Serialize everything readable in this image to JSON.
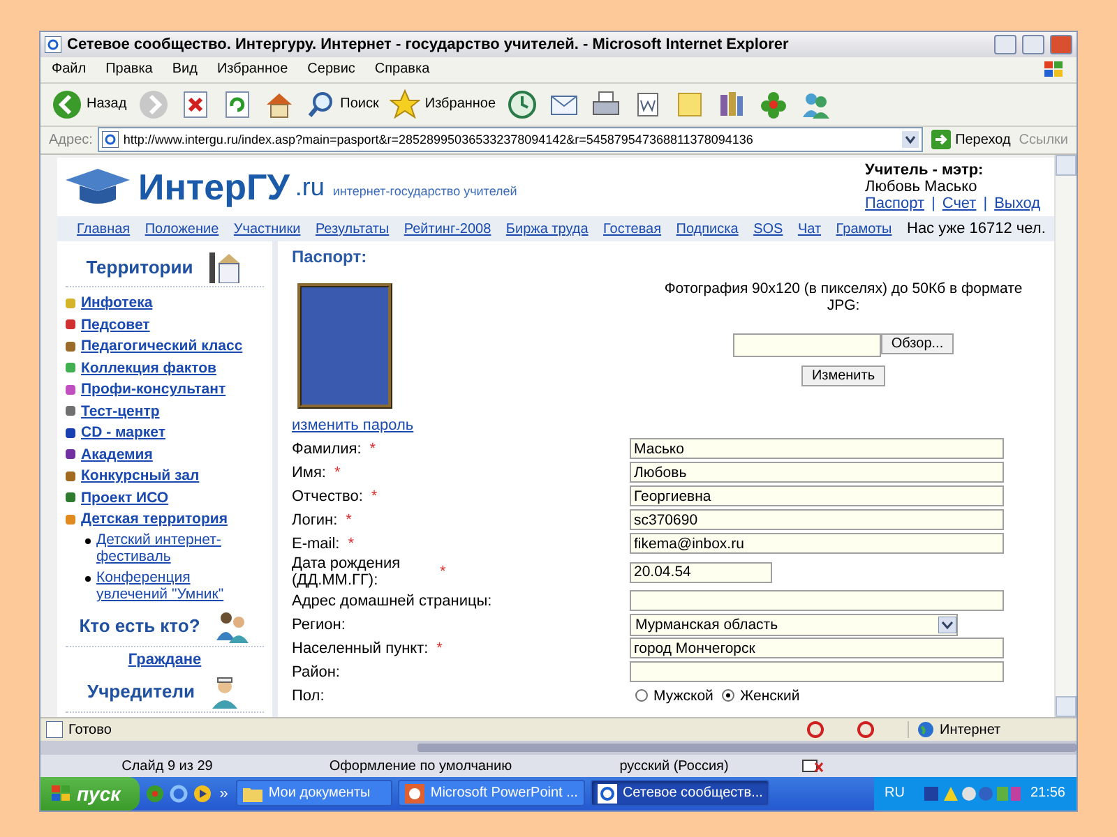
{
  "window": {
    "title": "Сетевое сообщество. Интергуру. Интернет - государство учителей. - Microsoft Internet Explorer"
  },
  "menu": [
    "Файл",
    "Правка",
    "Вид",
    "Избранное",
    "Сервис",
    "Справка"
  ],
  "toolbar": [
    {
      "kind": "back",
      "label": "Назад"
    },
    {
      "kind": "forward"
    },
    {
      "kind": "stop"
    },
    {
      "kind": "refresh"
    },
    {
      "kind": "home"
    },
    {
      "kind": "search",
      "label": "Поиск"
    },
    {
      "kind": "favorites",
      "label": "Избранное"
    },
    {
      "kind": "history"
    },
    {
      "kind": "mail"
    },
    {
      "kind": "print"
    },
    {
      "kind": "edit"
    },
    {
      "kind": "note"
    },
    {
      "kind": "research"
    },
    {
      "kind": "flower"
    },
    {
      "kind": "messenger"
    }
  ],
  "address": {
    "label": "Адрес:",
    "url": "http://www.intergu.ru/index.asp?main=pasport&r=285289950365332378094142&r=545879547368811378094136",
    "go": "Переход",
    "links": "Ссылки"
  },
  "page": {
    "logo": {
      "name": "ИнтерГУ",
      "domain": ".ru",
      "tagline": "интернет-государство учителей"
    },
    "user": {
      "role": "Учитель - мэтр:",
      "name": "Любовь Масько",
      "links": [
        {
          "kind": "link",
          "label": "Паспорт"
        },
        {
          "kind": "separator",
          "label": "|"
        },
        {
          "kind": "link",
          "label": "Счет"
        },
        {
          "kind": "separator",
          "label": "|"
        },
        {
          "kind": "link",
          "label": "Выход"
        }
      ]
    },
    "nav": [
      "Главная",
      "Положение",
      "Участники",
      "Результаты",
      "Рейтинг-2008",
      "Биржа труда",
      "Гостевая",
      "Подписка",
      "SOS",
      "Чат",
      "Грамоты"
    ],
    "counter": "Нас уже 16712 чел.",
    "sidebar": [
      {
        "title": "Территории",
        "items": [
          {
            "label": "Инфотека",
            "color": "#d4b52a"
          },
          {
            "label": "Педсовет",
            "color": "#d03030"
          },
          {
            "label": "Педагогический класс",
            "color": "#9a6a2a"
          },
          {
            "label": "Коллекция фактов",
            "color": "#40b050"
          },
          {
            "label": "Профи-консультант",
            "color": "#c050c0"
          },
          {
            "label": "Тест-центр",
            "color": "#707070"
          },
          {
            "label": "CD - маркет",
            "color": "#1840b0"
          },
          {
            "label": "Академия",
            "color": "#7030a0"
          },
          {
            "label": "Конкурсный зал",
            "color": "#a06a20"
          },
          {
            "label": "Проект ИСО",
            "color": "#2e7a2e"
          },
          {
            "label": "Детская территория",
            "color": "#e08a20",
            "children": [
              {
                "label": "Детский интернет-фестиваль"
              },
              {
                "label": "Конференция увлечений \"Умник\""
              }
            ]
          }
        ]
      },
      {
        "title": "Кто есть кто?",
        "items": [
          {
            "label": "Граждане"
          }
        ]
      },
      {
        "title": "Учредители"
      }
    ],
    "main": {
      "title": "Паспорт:",
      "change_password": "изменить пароль",
      "upload_note": "Фотография 90x120 (в пикселях) до 50Кб в формате JPG:",
      "browse": "Обзор...",
      "submit": "Изменить",
      "fields": [
        {
          "kind": "text",
          "label": "Фамилия:",
          "required_mark": "*",
          "value": "Масько"
        },
        {
          "kind": "text",
          "label": "Имя:",
          "required_mark": "*",
          "value": "Любовь"
        },
        {
          "kind": "text",
          "label": "Отчество:",
          "required_mark": "*",
          "value": "Георгиевна"
        },
        {
          "kind": "text",
          "label": "Логин:",
          "required_mark": "*",
          "value": "sc370690"
        },
        {
          "kind": "text",
          "label": "E-mail:",
          "required_mark": "*",
          "value": "fikema@inbox.ru"
        },
        {
          "kind": "short",
          "label": "Дата рождения (ДД.ММ.ГГ):",
          "required_mark": "*",
          "value": "20.04.54"
        },
        {
          "kind": "text",
          "label": "Адрес домашней страницы:"
        },
        {
          "kind": "select",
          "label": "Регион:",
          "value": "Мурманская область"
        },
        {
          "kind": "text",
          "label": "Населенный пункт:",
          "required_mark": "*",
          "value": "город Мончегорск"
        },
        {
          "kind": "text",
          "label": "Район:"
        },
        {
          "kind": "radio",
          "label": "Пол:",
          "options": [
            {
              "label": "Мужской",
              "selected": false
            },
            {
              "label": "Женский",
              "selected": true
            }
          ]
        }
      ]
    }
  },
  "ie_status": {
    "text": "Готово",
    "zone": "Интернет"
  },
  "ppt_status": [
    "Слайд 9 из 29",
    "Оформление по умолчанию",
    "русский (Россия)"
  ],
  "taskbar": {
    "start": "пуск",
    "more": "»",
    "tasks": [
      {
        "kind": "folder",
        "label": "Мои документы",
        "selected": false
      },
      {
        "kind": "ppt",
        "label": "Microsoft PowerPoint ...",
        "selected": false
      },
      {
        "kind": "ie",
        "label": "Сетевое сообществ...",
        "selected": true
      }
    ],
    "lang": "RU",
    "clock": "21:56"
  }
}
